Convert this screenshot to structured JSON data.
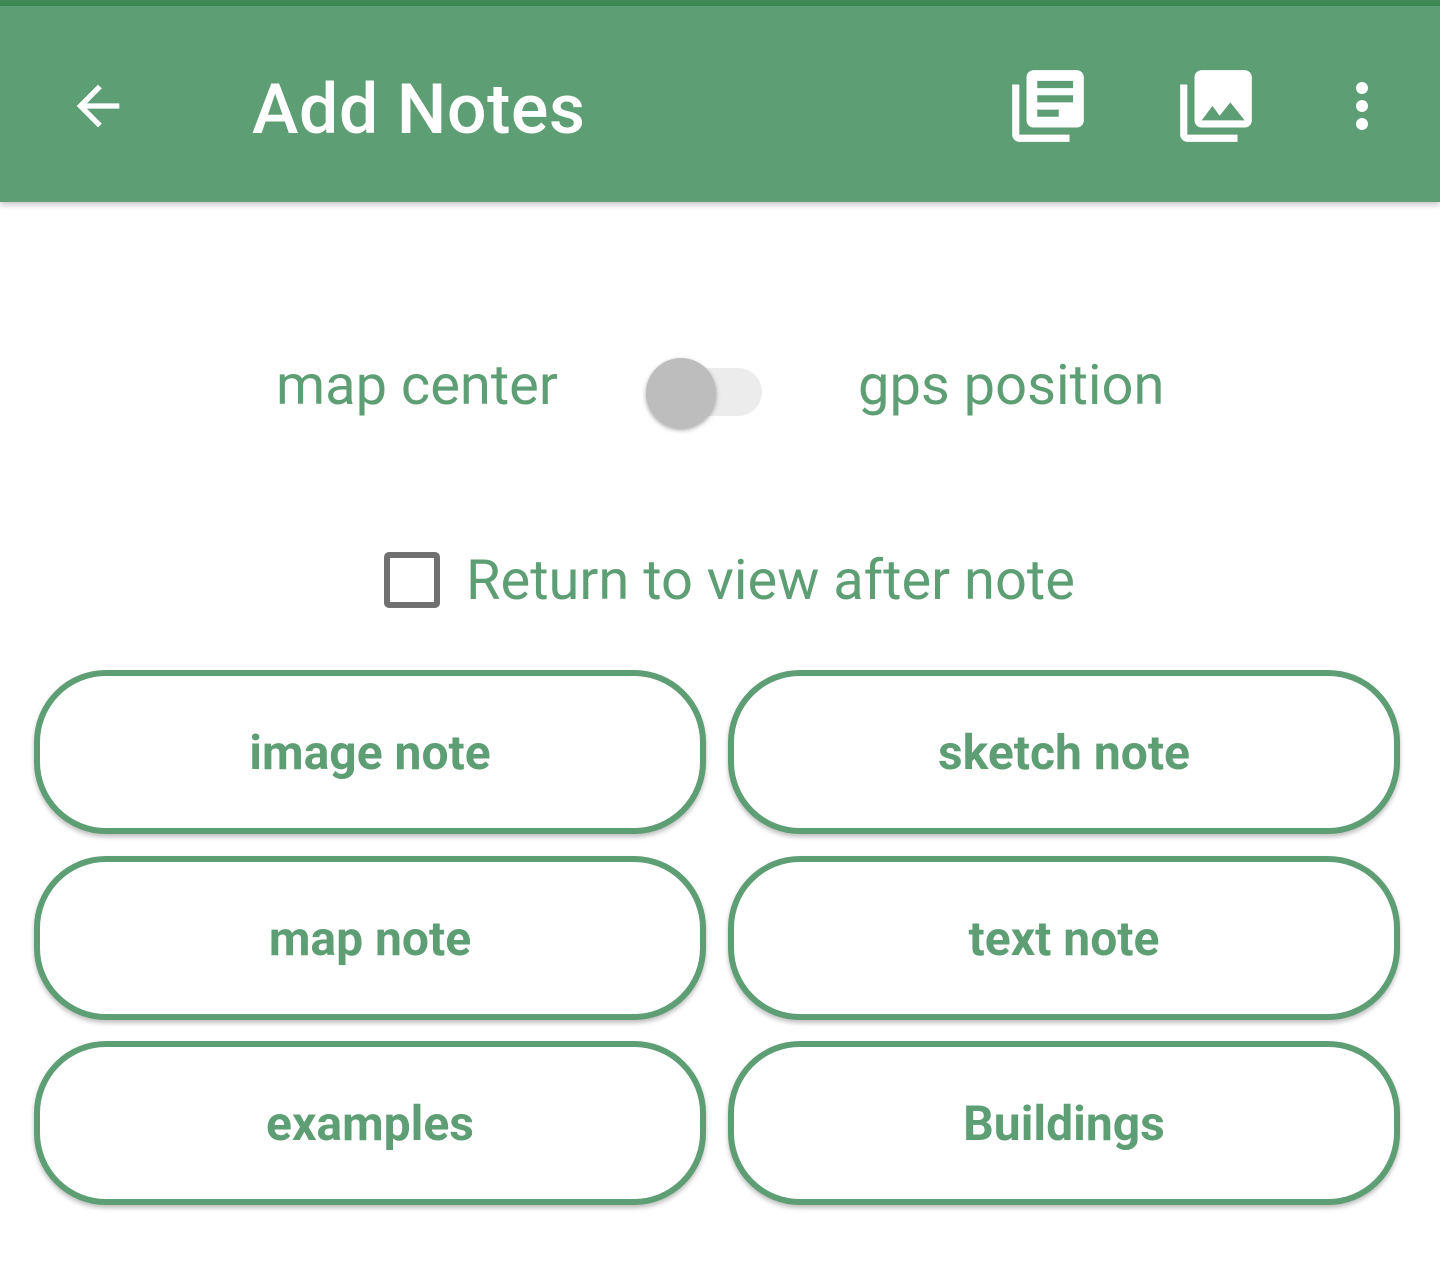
{
  "theme": {
    "primary": "#5e9e75",
    "status_bar": "#3f8a57",
    "on_primary": "#ffffff",
    "checkbox_border": "#707070",
    "switch_thumb": "#bdbdbd",
    "switch_track": "#ececec"
  },
  "app_bar": {
    "title": "Add Notes",
    "icons": {
      "back": "arrow-back-icon",
      "notes": "notes-list-icon",
      "gallery": "photo-library-icon",
      "more": "more-vert-icon"
    }
  },
  "position_toggle": {
    "left_label": "map center",
    "right_label": "gps position",
    "checked": false
  },
  "return_option": {
    "label": "Return to view after note",
    "checked": false
  },
  "note_buttons": [
    {
      "label": "image note"
    },
    {
      "label": "sketch note"
    },
    {
      "label": "map note"
    },
    {
      "label": "text note"
    },
    {
      "label": "examples"
    },
    {
      "label": "Buildings"
    }
  ]
}
